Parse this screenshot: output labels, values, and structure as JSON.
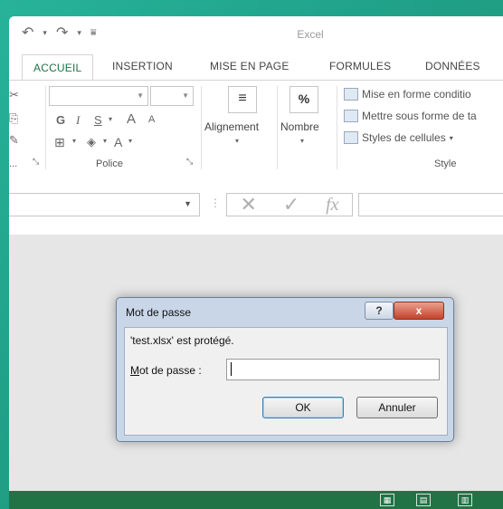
{
  "app": {
    "title": "Excel"
  },
  "qat": {
    "undo_icon": "undo-icon",
    "redo_icon": "redo-icon",
    "customize_icon": "customize-qat-icon"
  },
  "tabs": [
    {
      "label": "ACCUEIL",
      "active": true
    },
    {
      "label": "INSERTION"
    },
    {
      "label": "MISE EN PAGE"
    },
    {
      "label": "FORMULES"
    },
    {
      "label": "DONNÉES"
    }
  ],
  "ribbon": {
    "font_group_label": "Police",
    "bold": "G",
    "italic": "I",
    "underline": "S",
    "grow_font": "A",
    "shrink_font": "A",
    "font_color": "A",
    "alignment_label": "Alignement",
    "number_label": "Nombre",
    "number_symbol": "%",
    "style_group_label": "Style",
    "style_items": [
      "Mise en forme conditio",
      "Mettre sous forme de ta",
      "Styles de cellules"
    ],
    "clipboard_label_fragment": "..."
  },
  "formula_bar": {
    "fx_label": "fx"
  },
  "dialog": {
    "title": "Mot de passe",
    "help": "?",
    "close": "x",
    "message": "'test.xlsx' est protégé.",
    "label_mnemonic": "M",
    "label_rest": "ot de passe :",
    "password_value": "",
    "ok": "OK",
    "cancel": "Annuler"
  },
  "colors": {
    "accent": "#217346",
    "close_red": "#c4432a",
    "dialog_frame": "#c9d6e8"
  }
}
